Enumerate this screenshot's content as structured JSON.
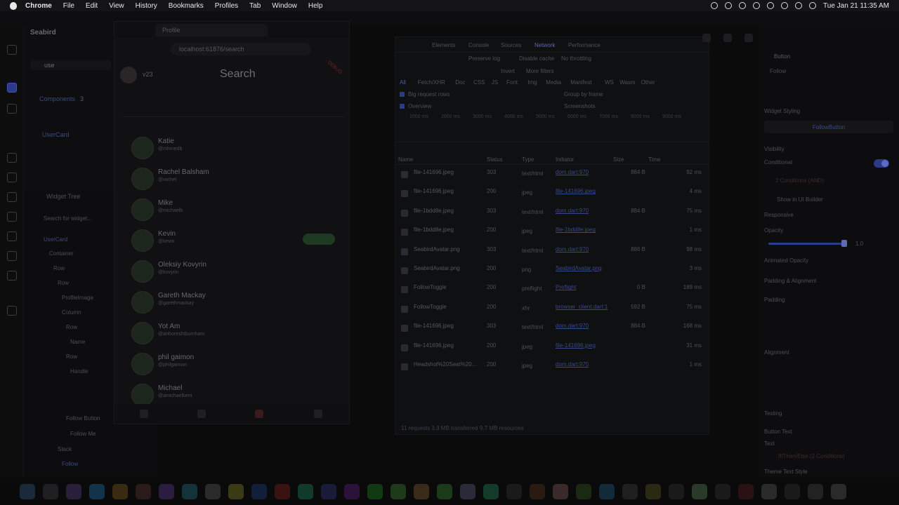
{
  "menubar": {
    "app": "Chrome",
    "items": [
      "File",
      "Edit",
      "View",
      "History",
      "Bookmarks",
      "Profiles",
      "Tab",
      "Window",
      "Help"
    ],
    "clock": "Tue Jan 21  11:35 AM"
  },
  "left_panel": {
    "project": "Seabird",
    "search_value": "use",
    "components_label": "Components",
    "components_count": "3",
    "items": [
      "UserCard"
    ],
    "widget_tree_label": "Widget Tree",
    "widget_search_placeholder": "Search for widget...",
    "root": "UserCard",
    "tree": [
      "Container",
      "Row",
      "Row",
      "ProfileImage",
      "Column",
      "Row",
      "Name",
      "Row",
      "Handle",
      "Follow Button",
      "Follow Me",
      "Stack",
      "Follow"
    ]
  },
  "chrome": {
    "tab_title": "Profile",
    "url": "localhost:61876/search",
    "version": "v23",
    "page_title": "Search",
    "debug": "DEBUG",
    "users": [
      {
        "name": "Katie",
        "handle": "@mhmedb",
        "following": false
      },
      {
        "name": "Rachel Balsham",
        "handle": "@rachel",
        "following": false
      },
      {
        "name": "Mike",
        "handle": "@michaelb",
        "following": false
      },
      {
        "name": "Kevin",
        "handle": "@kevin",
        "following": true
      },
      {
        "name": "Oleksiy Kovyrin",
        "handle": "@kovyrin",
        "following": false
      },
      {
        "name": "Gareth Mackay",
        "handle": "@garethmackay",
        "following": false
      },
      {
        "name": "Yot Am",
        "handle": "@arthoreshtburnham",
        "following": false
      },
      {
        "name": "phil gaimon",
        "handle": "@philgaimon",
        "following": false
      },
      {
        "name": "Michael",
        "handle": "@amichaelkent",
        "following": false
      }
    ]
  },
  "devtools": {
    "tabs": [
      "Elements",
      "Console",
      "Sources",
      "Network",
      "Performance"
    ],
    "active_tab": "Network",
    "preserve_log": "Preserve log",
    "disable_cache": "Disable cache",
    "throttle": "No throttling",
    "invert": "Invert",
    "more_filters": "More filters",
    "types": [
      "All",
      "Fetch/XHR",
      "Doc",
      "CSS",
      "JS",
      "Font",
      "Img",
      "Media",
      "Manifest",
      "WS",
      "Wasm",
      "Other"
    ],
    "big_rows": "Big request rows",
    "group_by_frame": "Group by frame",
    "overview": "Overview",
    "screenshots": "Screenshots",
    "ticks": [
      "1000 ms",
      "2000 ms",
      "3000 ms",
      "4000 ms",
      "5000 ms",
      "6000 ms",
      "7000 ms",
      "8000 ms",
      "9000 ms"
    ],
    "columns": [
      "Name",
      "Status",
      "Type",
      "Initiator",
      "Size",
      "Time"
    ],
    "requests": [
      {
        "name": "file-141696.jpeg",
        "status": "303",
        "type": "text/html",
        "initiator": "dom.dart:970",
        "size": "884 B",
        "time": "92 ms"
      },
      {
        "name": "file-141696.jpeg",
        "status": "200",
        "type": "jpeg",
        "initiator": "file-141696.jpeg",
        "size": "",
        "time": "4 ms"
      },
      {
        "name": "file-1bdd8e.jpeg",
        "status": "303",
        "type": "text/html",
        "initiator": "dom.dart:970",
        "size": "884 B",
        "time": "75 ms"
      },
      {
        "name": "file-1bdd8e.jpeg",
        "status": "200",
        "type": "jpeg",
        "initiator": "file-1bdd8e.jpeg",
        "size": "",
        "time": "1 ms"
      },
      {
        "name": "SeabirdAvatar.png",
        "status": "303",
        "type": "text/html",
        "initiator": "dom.dart:970",
        "size": "886 B",
        "time": "98 ms"
      },
      {
        "name": "SeabirdAvatar.png",
        "status": "200",
        "type": "png",
        "initiator": "SeabirdAvatar.png",
        "size": "",
        "time": "3 ms"
      },
      {
        "name": "FollowToggle",
        "status": "200",
        "type": "preflight",
        "initiator": "Preflight",
        "size": "0 B",
        "time": "189 ms"
      },
      {
        "name": "FollowToggle",
        "status": "200",
        "type": "xhr",
        "initiator": "browser_client.dart:1",
        "size": "592 B",
        "time": "75 ms"
      },
      {
        "name": "file-141696.jpeg",
        "status": "303",
        "type": "text/html",
        "initiator": "dom.dart:970",
        "size": "884 B",
        "time": "168 ms"
      },
      {
        "name": "file-141696.jpeg",
        "status": "200",
        "type": "jpeg",
        "initiator": "file-141696.jpeg",
        "size": "",
        "time": "31 ms"
      },
      {
        "name": "Headshot%20Seat%20...",
        "status": "200",
        "type": "jpeg",
        "initiator": "dom.dart:970",
        "size": "",
        "time": "1 ms"
      }
    ],
    "status_bar": "11 requests    3.3 MB transferred    9.7 MB resources"
  },
  "right_panel": {
    "widget_type": "Button",
    "widget_name": "Follow",
    "widget_styling": "Widget Styling",
    "style_name": "FollowButton",
    "visibility": "Visibility",
    "conditional": "Conditional",
    "conditions": "2 Conditions (AND)",
    "show_in_ui": "Show in UI Builder",
    "responsive": "Responsive",
    "opacity": "Opacity",
    "opacity_value": "1.0",
    "opacity_level": 1.0,
    "animated_opacity": "Animated Opacity",
    "padding_alignment": "Padding & Alignment",
    "padding": "Padding",
    "alignment": "Alignment",
    "testing": "Testing",
    "button_text": "Button Text",
    "text": "Text",
    "text_value": "If/Then/Else (2 Conditions)",
    "theme_text_style": "Theme Text Style"
  }
}
